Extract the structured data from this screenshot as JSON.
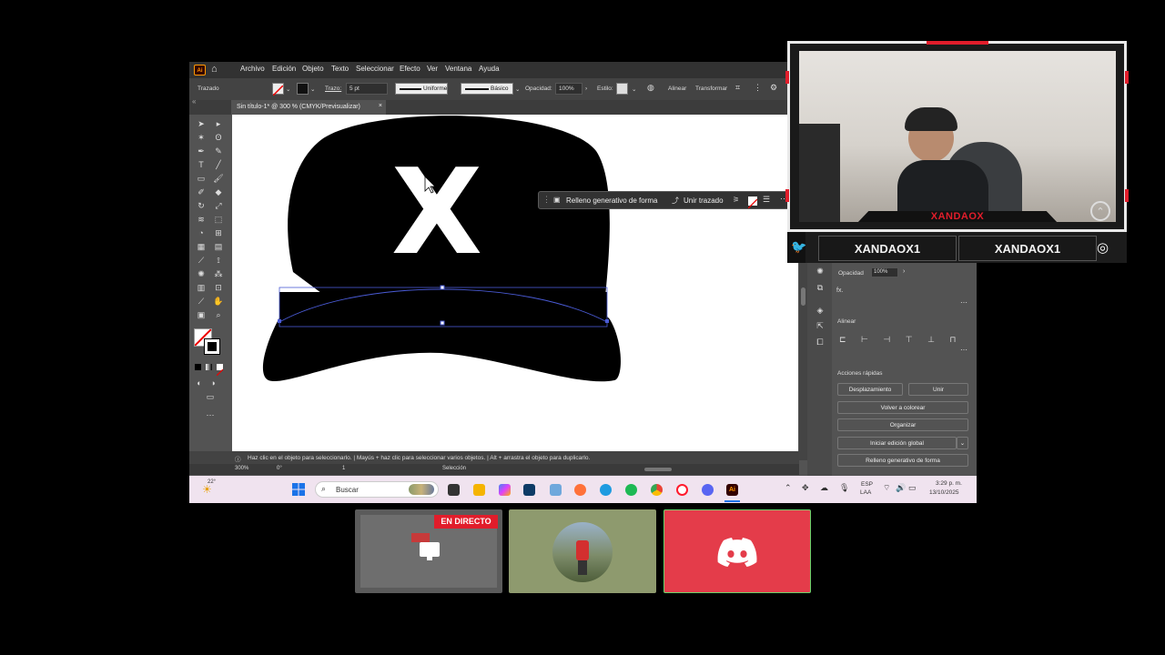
{
  "menu": {
    "items": [
      "Archivo",
      "Edición",
      "Objeto",
      "Texto",
      "Seleccionar",
      "Efecto",
      "Ver",
      "Ventana",
      "Ayuda"
    ],
    "logo": "Ai"
  },
  "control": {
    "trazado_label": "Trazado",
    "trazo_label": "Trazo:",
    "trazo_value": "5 pt",
    "uniforme": "Uniforme",
    "basico": "Básico",
    "opacidad_label": "Opacidad:",
    "opacidad_value": "100%",
    "estilo_label": "Estilo:",
    "alinear": "Alinear",
    "transformar": "Transformar"
  },
  "document": {
    "tab_title": "Sin título-1* @ 300 % (CMYK/Previsualizar)",
    "close_glyph": "×"
  },
  "artwork": {
    "cap_letter": "X"
  },
  "contextual_bar": {
    "generative_fill": "Relleno generativo de forma",
    "join_path": "Unir trazado"
  },
  "status": {
    "hint": "Haz clic en el objeto para seleccionarlo. | Mayús + haz clic para seleccionar varios objetos. | Alt + arrastra el objeto para duplicarlo.",
    "zoom": "300%",
    "rotation": "0°",
    "artboard": "1",
    "mode": "Selección"
  },
  "properties": {
    "opacidad_label": "Opacidad",
    "opacidad_value": "100%",
    "fx": "fx.",
    "alinear_title": "Alinear",
    "acciones_title": "Acciones rápidas",
    "desplazamiento": "Desplazamiento",
    "unir": "Unir",
    "volver_colorear": "Volver a colorear",
    "organizar": "Organizar",
    "edicion_global": "Iniciar edición global",
    "relleno_generativo": "Relleno generativo de forma"
  },
  "taskbar": {
    "weather_temp": "22°",
    "search_placeholder": "Buscar",
    "lang_top": "ESP",
    "lang_bottom": "LAA",
    "time": "3:29 p. m.",
    "date": "13/10/2025"
  },
  "webcam": {
    "overlay_name": "XANDAOX",
    "social_left": "XANDAOX1",
    "social_right": "XANDAOX1"
  },
  "thumbnails": {
    "live_badge": "EN DIRECTO"
  },
  "colors": {
    "accent_red": "#e11d2b",
    "discord_red": "#e43c4a",
    "ai_orange": "#ff9a00"
  }
}
